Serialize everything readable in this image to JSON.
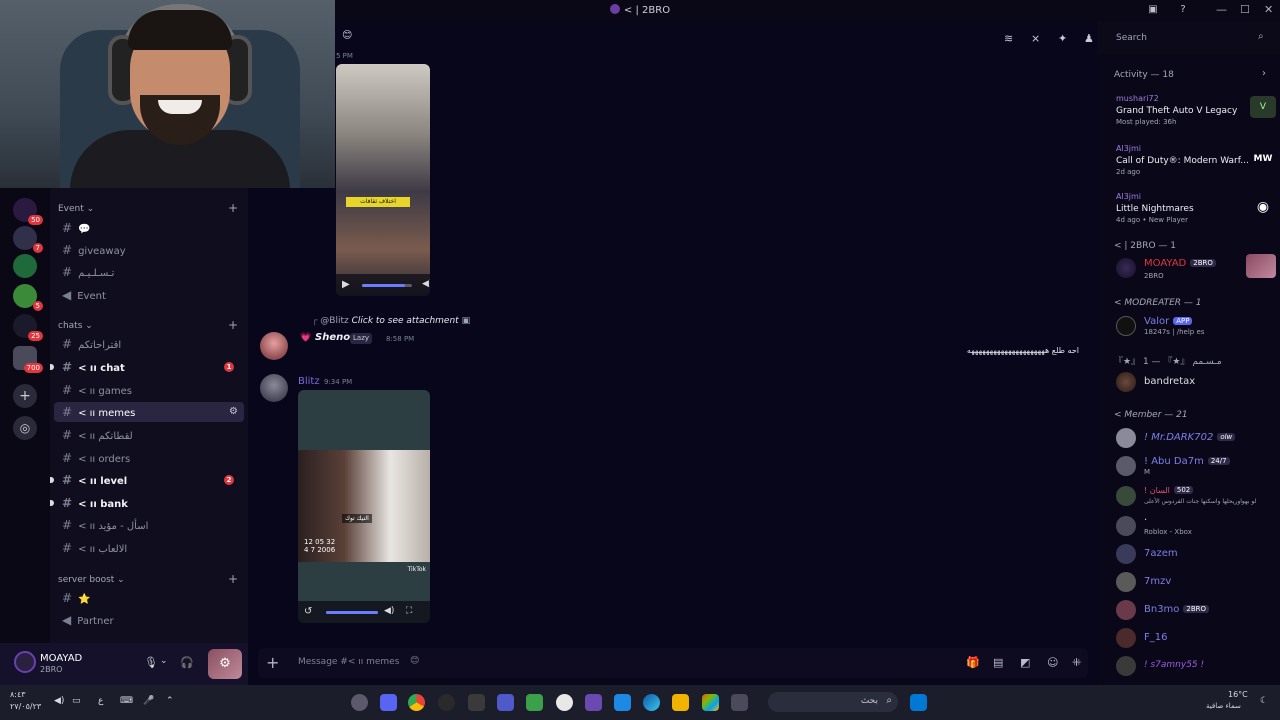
{
  "window": {
    "title": "< | 2BRO"
  },
  "search": {
    "placeholder": "Search"
  },
  "sidebar": {
    "categories": {
      "event": "Event",
      "chats": "chats",
      "server_boost": "server boost"
    },
    "channels": {
      "c1": "",
      "giveaway": "giveaway",
      "taslim": "تـسـلـيـم",
      "event": "Event",
      "iqtirahatkom": "اقتراحاتكم",
      "chat": "< ıı chat",
      "games": "< ıı games",
      "memes": "< ıı memes",
      "lqtatkom": "< ıı لقطاتكم",
      "orders": "< ıı orders",
      "level": "< ıı level",
      "bank": "< ıı bank",
      "asal": "< ıı اسأل - مؤيد",
      "alaab": "< ıı الالعاب",
      "star": "",
      "partner": "Partner"
    },
    "badges": {
      "chat": "1",
      "level": "2"
    }
  },
  "servers": {
    "badges": [
      "50",
      "7",
      "5",
      "25",
      "700"
    ]
  },
  "user_panel": {
    "name": "MOAYAD",
    "tag": "2BRO"
  },
  "chat": {
    "channel": "< ıı memes",
    "top_ts": "5 PM",
    "media_caption": "اختلاف ثقافات",
    "reply_author": "@Blitz",
    "reply_text": "Click to see attachment",
    "msg1_author": "Sheno",
    "msg1_tag": "Lazy",
    "msg1_time": "8:58 PM",
    "msg1_text": "احه طلع هههههههههههههههههههههه",
    "msg2_author": "Blitz",
    "msg2_time": "9:34 PM",
    "media2_stamp": "12 05 32\n4 7 2006",
    "media2_caption": "التيك توك",
    "media2_tiktok": "TikTok",
    "composer_placeholder": "Message #< ıı memes"
  },
  "members": {
    "activity_header": "Activity — 18",
    "activities": [
      {
        "user": "mushari72",
        "title": "Grand Theft Auto V Legacy",
        "sub": "Most played: 36h"
      },
      {
        "user": "Al3jmi",
        "title": "Call of Duty®: Modern Warf...",
        "sub": "2d ago"
      },
      {
        "user": "Al3jmi",
        "title": "Little Nightmares",
        "sub": "4d ago  •  New Player"
      }
    ],
    "roles": [
      {
        "name": "< | 2BRO — 1"
      },
      {
        "name": "< MODREATER — 1"
      },
      {
        "name": "『★』 مـسـمم 『★』 — 1"
      },
      {
        "name": "< Member — 21"
      }
    ],
    "list": [
      {
        "name": "MOAYAD",
        "badge": "2BRO",
        "sub": "2BRO",
        "color": "#e0363e"
      },
      {
        "name": "Valor",
        "badge": "APP",
        "sub": "18247s | /help es",
        "color": "#7c7fe8"
      },
      {
        "name": "bandretax",
        "badge": "",
        "sub": "",
        "color": "#dbdee1"
      },
      {
        "name": "! Mr.DARK702",
        "badge": "olw",
        "sub": "",
        "color": "#7c7fe8"
      },
      {
        "name": "! Abu Da7m",
        "badge": "24/7",
        "sub": "M",
        "color": "#7c7fe8"
      },
      {
        "name": "! السان",
        "badge": "502",
        "sub": "لو بهواوريحلها واسكنها جنات الفردوس الأعلى",
        "color": "#e05070"
      },
      {
        "name": ".",
        "badge": "",
        "sub": "Roblox - Xbox",
        "color": "#dbdee1"
      },
      {
        "name": "7azem",
        "badge": "",
        "sub": "",
        "color": "#7c7fe8"
      },
      {
        "name": "7mzv",
        "badge": "",
        "sub": "",
        "color": "#7c7fe8"
      },
      {
        "name": "Bn3mo",
        "badge": "2BRO",
        "sub": "",
        "color": "#7c7fe8"
      },
      {
        "name": "F_16",
        "badge": "",
        "sub": "",
        "color": "#7c7fe8"
      },
      {
        "name": "! s7amny55 !",
        "badge": "",
        "sub": "",
        "color": "#9c5ee8"
      }
    ]
  },
  "taskbar": {
    "time": "٨:٤٣",
    "date": "٢٧/٠٥/٢٣",
    "lang": "ع",
    "search": "بحث",
    "weather_temp": "16°C",
    "weather_text": "سماء صافية"
  }
}
